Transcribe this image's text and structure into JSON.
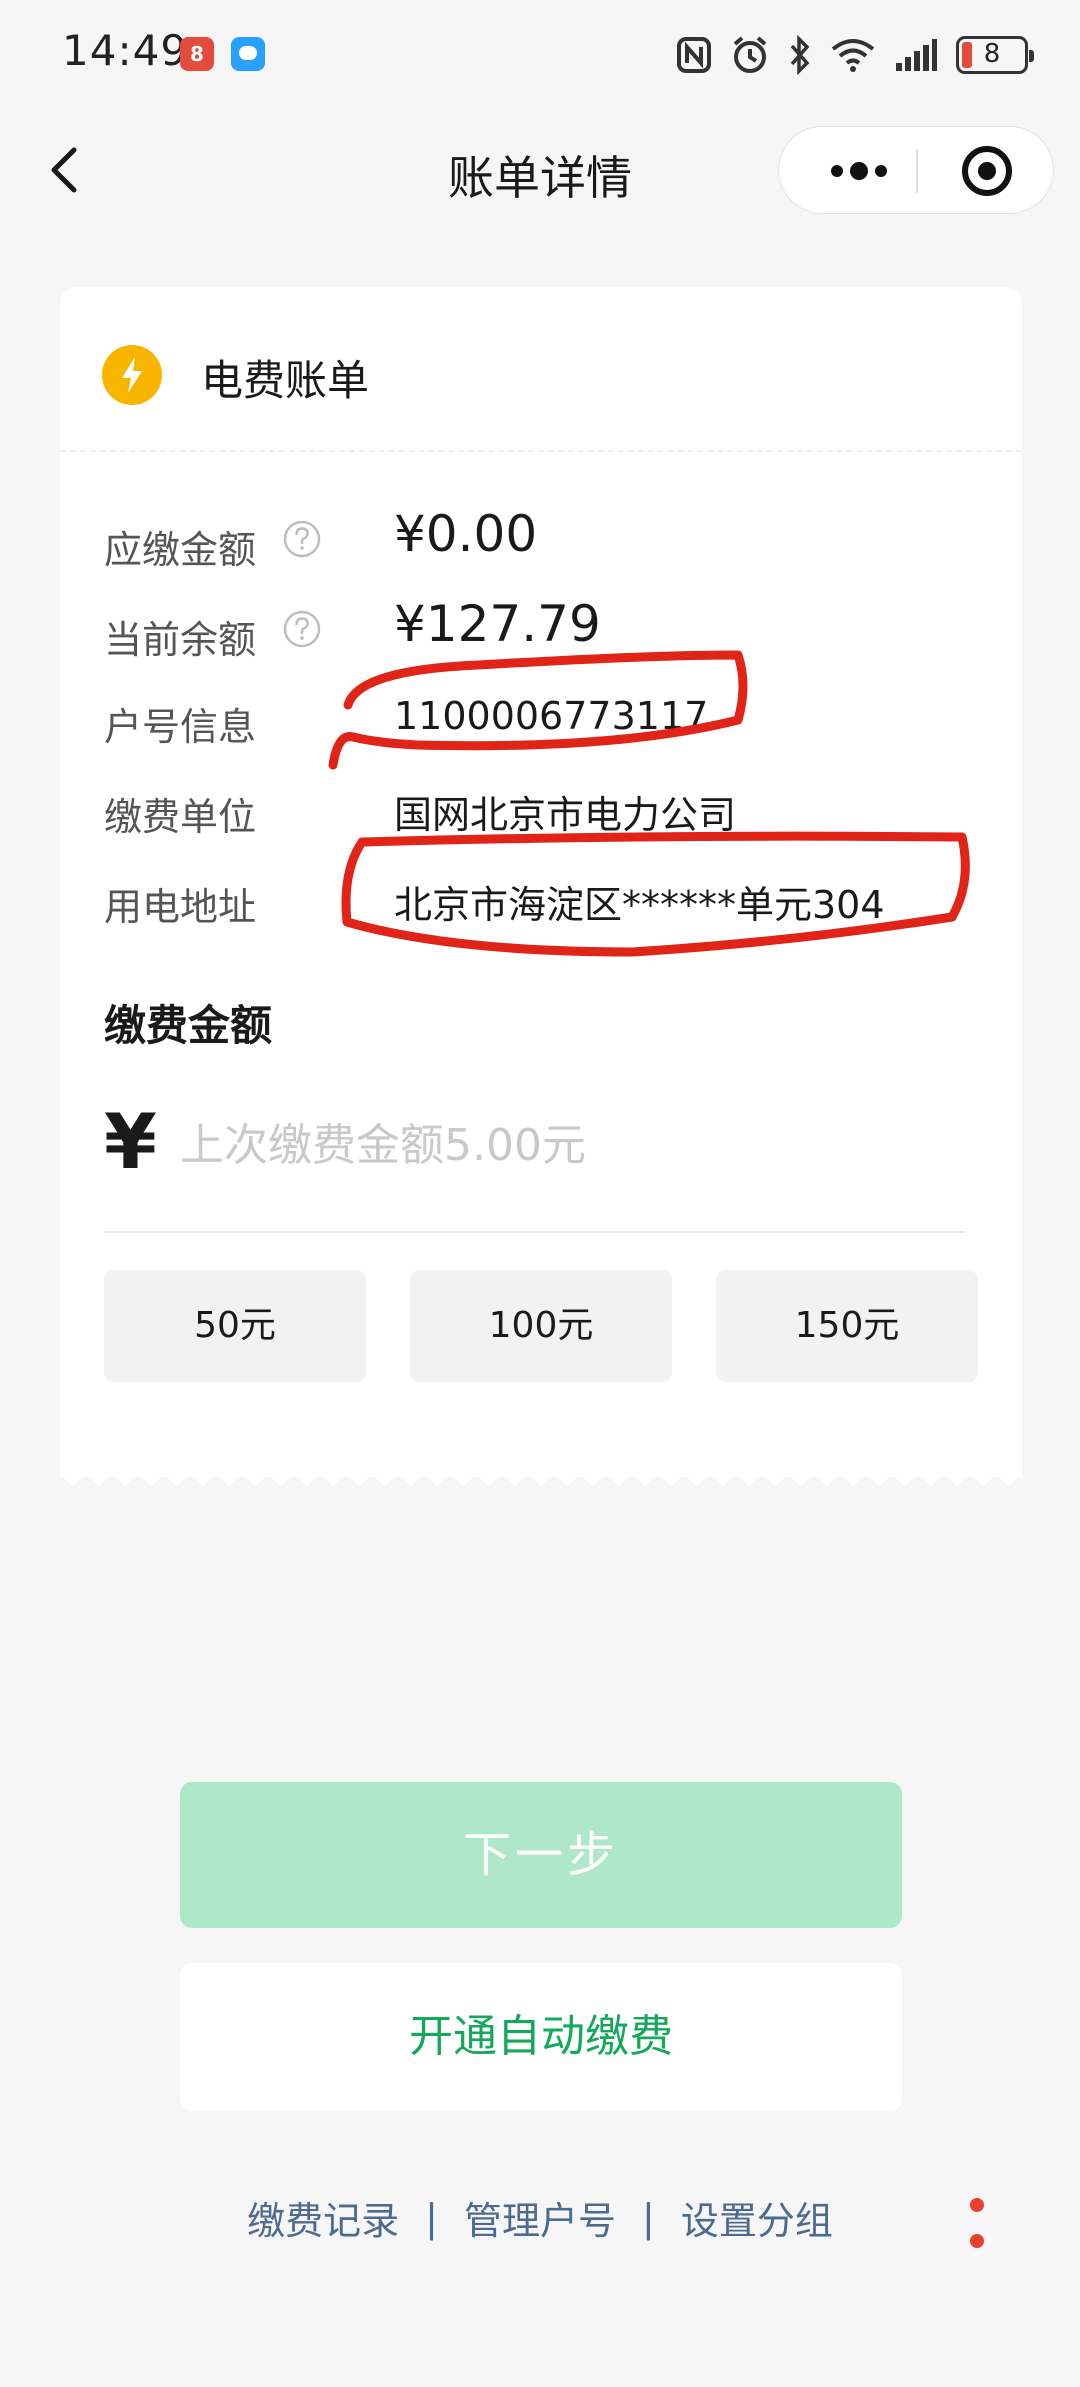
{
  "status_bar": {
    "time": "14:49",
    "battery": "8",
    "notification_badge": "8"
  },
  "nav": {
    "title": "账单详情"
  },
  "bill": {
    "title": "电费账单",
    "rows": [
      {
        "label": "应缴金额",
        "value": "¥0.00"
      },
      {
        "label": "当前余额",
        "value": "¥127.79"
      },
      {
        "label": "户号信息",
        "value": "1100006773117"
      },
      {
        "label": "缴费单位",
        "value": "国网北京市电力公司"
      },
      {
        "label": "用电地址",
        "value": "北京市海淀区******单元304"
      }
    ]
  },
  "payment": {
    "title": "缴费金额",
    "currency": "¥",
    "placeholder": "上次缴费金额5.00元",
    "quick_amounts": [
      "50元",
      "100元",
      "150元"
    ]
  },
  "actions": {
    "next": "下一步",
    "autopay": "开通自动缴费"
  },
  "links": {
    "record": "缴费记录",
    "manage": "管理户号",
    "group": "设置分组",
    "separator": "|"
  },
  "colors": {
    "accent_green": "#14a85a",
    "disabled_green": "#aee8c8",
    "link_blue": "#4f6a8f",
    "bolt_yellow": "#f7b500",
    "annotation_red": "#e02418"
  }
}
